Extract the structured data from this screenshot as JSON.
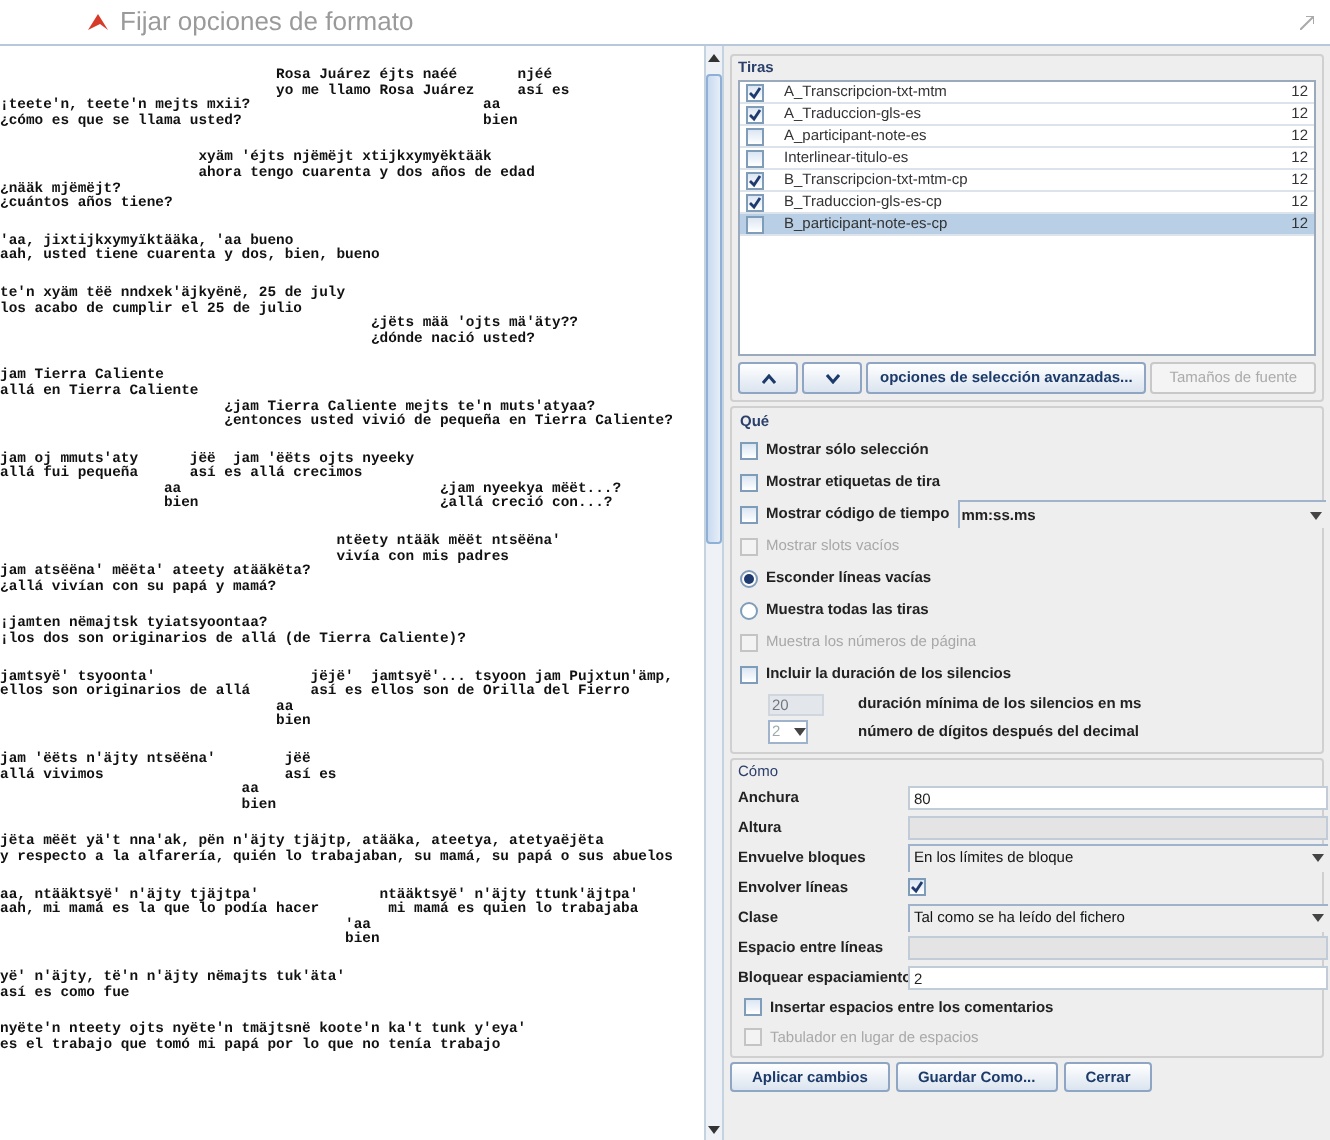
{
  "window": {
    "title": "Fijar opciones de formato"
  },
  "preview": {
    "blocks": [
      {
        "lines": [
          "                                Rosa Juárez éjts naéé       njéé",
          "                                yo me llamo Rosa Juárez     así es",
          "¡teete'n, teete'n mejts mxii?                           aa",
          "¿cómo es que se llama usted?                            bien"
        ]
      },
      {
        "lines": [
          "                       xyäm 'éjts njëmëjt xtijkxymyëktääk",
          "                       ahora tengo cuarenta y dos años de edad",
          "¿nääk mjëmëjt?",
          "¿cuántos años tiene?"
        ]
      },
      {
        "lines": [
          "'aa, jixtijkxymyïktääka, 'aa bueno",
          "aah, usted tiene cuarenta y dos, bien, bueno"
        ]
      },
      {
        "lines": [
          "te'n xyäm tëë nndxek'äjkyënë, 25 de july",
          "los acabo de cumplir el 25 de julio",
          "                                           ¿jëts mää 'ojts mä'äty??",
          "                                           ¿dónde nació usted?"
        ]
      },
      {
        "lines": [
          "jam Tierra Caliente",
          "allá en Tierra Caliente",
          "                          ¿jam Tierra Caliente mejts te'n muts'atyaa?",
          "                          ¿entonces usted vivió de pequeña en Tierra Caliente?"
        ]
      },
      {
        "lines": [
          "jam oj mmuts'aty      jëë  jam 'ëëts ojts nyeeky",
          "allá fui pequeña      así es allá crecimos",
          "                   aa                              ¿jam nyeekya mëët...?",
          "                   bien                            ¿allá creció con...?"
        ]
      },
      {
        "lines": [
          "                                       ntëety ntääk mëët ntsëëna'",
          "                                       vivía con mis padres",
          "jam atsëëna' mëëta' ateety atääkëta?",
          "¿allá vivían con su papá y mamá?"
        ]
      },
      {
        "lines": [
          "¡jamten nëmajtsk tyiatsyoontaa?",
          "¡los dos son originarios de allá (de Tierra Caliente)?"
        ]
      },
      {
        "lines": [
          "jamtsyë' tsyoonta'                  jëjë'  jamtsyë'... tsyoon jam Pujxtun'ämp,",
          "ellos son originarios de allá       así es ellos son de Orilla del Fierro",
          "                                aa",
          "                                bien"
        ]
      },
      {
        "lines": [
          "jam 'ëëts n'äjty ntsëëna'        jëë",
          "allá vivimos                     así es",
          "                            aa",
          "                            bien"
        ]
      },
      {
        "lines": [
          "jëta mëët yä't nna'ak, pën n'äjty tjäjtp, atääka, ateetya, atetyaëjëta",
          "y respecto a la alfarería, quién lo trabajaban, su mamá, su papá o sus abuelos"
        ]
      },
      {
        "lines": [
          "aa, ntääktsyë' n'äjty tjäjtpa'              ntääktsyë' n'äjty ttunk'äjtpa'",
          "aah, mi mamá es la que lo podía hacer        mi mamá es quien lo trabajaba",
          "                                        'aa",
          "                                        bien"
        ]
      },
      {
        "lines": [
          "yë' n'äjty, të'n n'äjty nëmajts tuk'äta'",
          "así es como fue"
        ]
      },
      {
        "lines": [
          "nyëte'n nteety ojts nyëte'n tmäjtsnë koote'n ka't tunk y'eya'",
          "es el trabajo que tomó mi papá por lo que no tenía trabajo"
        ]
      }
    ]
  },
  "tiers": {
    "title": "Tiras",
    "items": [
      {
        "name": "A_Transcripcion-txt-mtm",
        "size": "12",
        "checked": true,
        "selected": false
      },
      {
        "name": "A_Traduccion-gls-es",
        "size": "12",
        "checked": true,
        "selected": false
      },
      {
        "name": "A_participant-note-es",
        "size": "12",
        "checked": false,
        "selected": false
      },
      {
        "name": "Interlinear-titulo-es",
        "size": "12",
        "checked": false,
        "selected": false
      },
      {
        "name": "B_Transcripcion-txt-mtm-cp",
        "size": "12",
        "checked": true,
        "selected": false
      },
      {
        "name": "B_Traduccion-gls-es-cp",
        "size": "12",
        "checked": true,
        "selected": false
      },
      {
        "name": "B_participant-note-es-cp",
        "size": "12",
        "checked": false,
        "selected": true
      }
    ]
  },
  "tier_buttons": [
    {
      "kind": "up",
      "disabled": false
    },
    {
      "kind": "down",
      "disabled": false
    },
    {
      "kind": "text",
      "label": "opciones de selección avanzadas...",
      "disabled": false
    },
    {
      "kind": "text",
      "label": "Tamaños de fuente",
      "disabled": true
    }
  ],
  "que": {
    "title": "Qué",
    "options": [
      {
        "kind": "checkbox",
        "label": "Mostrar sólo selección",
        "checked": false,
        "disabled": false
      },
      {
        "kind": "checkbox",
        "label": "Mostrar etiquetas de tira",
        "checked": false,
        "disabled": false
      },
      {
        "kind": "checkbox",
        "label": "Mostrar código de tiempo",
        "checked": false,
        "disabled": false,
        "dropdown": "mm:ss.ms"
      },
      {
        "kind": "checkbox",
        "label": "Mostrar slots vacíos",
        "checked": false,
        "disabled": true
      },
      {
        "kind": "radio",
        "label": "Esconder líneas vacías",
        "selected": true,
        "disabled": false
      },
      {
        "kind": "radio",
        "label": "Muestra todas las tiras",
        "selected": false,
        "disabled": false
      },
      {
        "kind": "checkbox",
        "label": "Muestra los números de página",
        "checked": false,
        "disabled": true
      },
      {
        "kind": "checkbox",
        "label": "Incluir la duración de los silencios",
        "checked": false,
        "disabled": false
      }
    ],
    "silence": [
      {
        "kind": "field",
        "value": "20",
        "label": "duración mínima de los silencios en ms",
        "disabled": true
      },
      {
        "kind": "spinner",
        "value": "2",
        "label": "número de dígitos después del decimal",
        "disabled": true
      }
    ]
  },
  "como": {
    "title": "Cómo",
    "rows": [
      {
        "kind": "text",
        "label": "Anchura",
        "value": "80",
        "disabled": false
      },
      {
        "kind": "text",
        "label": "Altura",
        "disabled": true
      },
      {
        "kind": "combo",
        "label": "Envuelve bloques",
        "value": "En los límites de bloque",
        "disabled": false
      },
      {
        "kind": "checkbox",
        "label": "Envolver líneas",
        "checked": true,
        "disabled": false
      },
      {
        "kind": "combo",
        "label": "Clase",
        "value": "Tal como se ha leído del fichero",
        "disabled": false
      },
      {
        "kind": "text",
        "label": "Espacio entre líneas",
        "disabled": true
      },
      {
        "kind": "text",
        "label": "Bloquear espaciamiento",
        "value": "2",
        "disabled": false
      }
    ],
    "options": [
      {
        "label": "Insertar espacios entre los comentarios",
        "checked": false,
        "disabled": false
      },
      {
        "label": "Tabulador en lugar de espacios",
        "checked": false,
        "disabled": true
      }
    ]
  },
  "buttons": [
    "Aplicar cambios",
    "Guardar Como...",
    "Cerrar"
  ]
}
